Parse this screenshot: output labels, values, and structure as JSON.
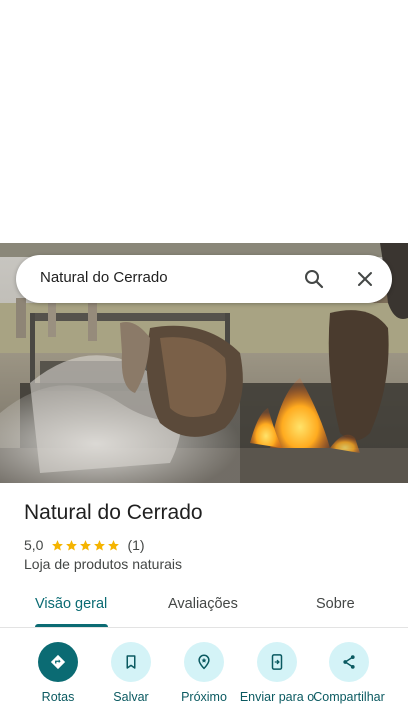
{
  "search": {
    "query": "Natural do Cerrado"
  },
  "place": {
    "name": "Natural do Cerrado",
    "rating": "5,0",
    "stars": 5,
    "review_count": "(1)",
    "category": "Loja de produtos naturais"
  },
  "tabs": [
    {
      "label": "Visão geral",
      "active": true
    },
    {
      "label": "Avaliações",
      "active": false
    },
    {
      "label": "Sobre",
      "active": false
    }
  ],
  "actions": [
    {
      "label": "Rotas",
      "icon": "directions-icon",
      "primary": true
    },
    {
      "label": "Salvar",
      "icon": "bookmark-icon",
      "primary": false
    },
    {
      "label": "Próximo",
      "icon": "nearby-icon",
      "primary": false
    },
    {
      "label": "Enviar para o",
      "icon": "send-to-phone-icon",
      "primary": false
    },
    {
      "label": "Compartilhar",
      "icon": "share-icon",
      "primary": false
    }
  ],
  "colors": {
    "accent": "#0b6b73",
    "action_bg": "#d4f3f7",
    "star": "#f5b400"
  }
}
